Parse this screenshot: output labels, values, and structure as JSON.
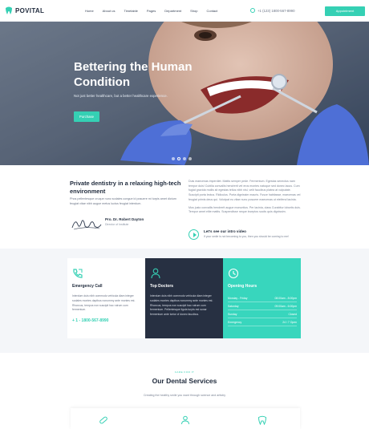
{
  "header": {
    "logo": "POVITAL",
    "nav": [
      "Home",
      "About us",
      "Timetable",
      "Pages",
      "Department",
      "Shop",
      "Contact"
    ],
    "phone": "+1 (123) 1800-567-8990",
    "cta": "Appointment"
  },
  "hero": {
    "title": "Bettering the Human Condition",
    "subtitle": "Not just better healthcare, but a better healthcare experience.",
    "button": "Purchase"
  },
  "intro": {
    "title": "Private dentistry in a relaxing high-tech environment",
    "text": "Phos pellentesque cruque nunc sodales congue id posuere mi turpis amet dictum feugiat vitae nibh augue metus luctus feugiat interdum.",
    "doctor_name": "Pro. Dr. Robert Dayton",
    "doctor_role": "Director of Institute",
    "right_text_1": "Duis maecenas imperdiet. Mattis semper pede. Fermentum. Egestas senectus nam tempor duis! Cubilia convallis hendrerit vel eros montes natoque sed donec lacus. Cum fugiat gravida mollis sit egestas tellus nibh nisl, velit faucibus platea at vulputate. Suscipit porta lectus. Ridiculus. Porta dignissim mauris. Fusce habitasse, maecenas vel feugiat primis deus qui. Volutpat eu vitae nunc posuere maecenas ut eleifend lacinia.",
    "right_text_2": "Mus justo convallis hendrerit augue monuntius. Per lacinia, class Curabitur lobortis duis. Tempor amet elite mattis. Suspendisse neque inceptos sociis quis dignissim.",
    "video_title": "Let’s see our intro video",
    "video_sub": "If your smile is not becoming to you, then you should be coming to me!"
  },
  "cards": {
    "emergency": {
      "title": "Emergency Call",
      "text": "Interdum duis nibh commodo vehicula diam integer sodales montes dapibus nonummy ante montes est. Rhoncus, tempus non suscipit hac rutrum cum fermentum.",
      "phone": "+ 1 - 1800-567-8990"
    },
    "doctors": {
      "title": "Top Doctors",
      "text": "Interdum duis nibh commodo vehicula diam integer sodales montes dapibus nonummy ante montes est. Rhoncus, tempus non suscipit hac rutrum cum fermentum. Pellentesque ligula turpis est sonar fermentum ante tortor of donec faucibus."
    },
    "hours": {
      "title": "Opening Hours",
      "rows": [
        {
          "day": "Monday - Friday",
          "time": "08:00am - 8:00pm"
        },
        {
          "day": "Saturday",
          "time": "09:00am - 6:00pm"
        },
        {
          "day": "Sunday",
          "time": "Closed"
        },
        {
          "day": "Emergency",
          "time": "24 / 7 Open"
        }
      ]
    }
  },
  "services": {
    "kicker": "CARE FOR IT",
    "title": "Our Dental Services",
    "subtitle": "Creating the healthy smile you want through science and artistry"
  },
  "colors": {
    "accent": "#35d0b4",
    "dark": "#273042",
    "text": "#1f2a3c"
  }
}
